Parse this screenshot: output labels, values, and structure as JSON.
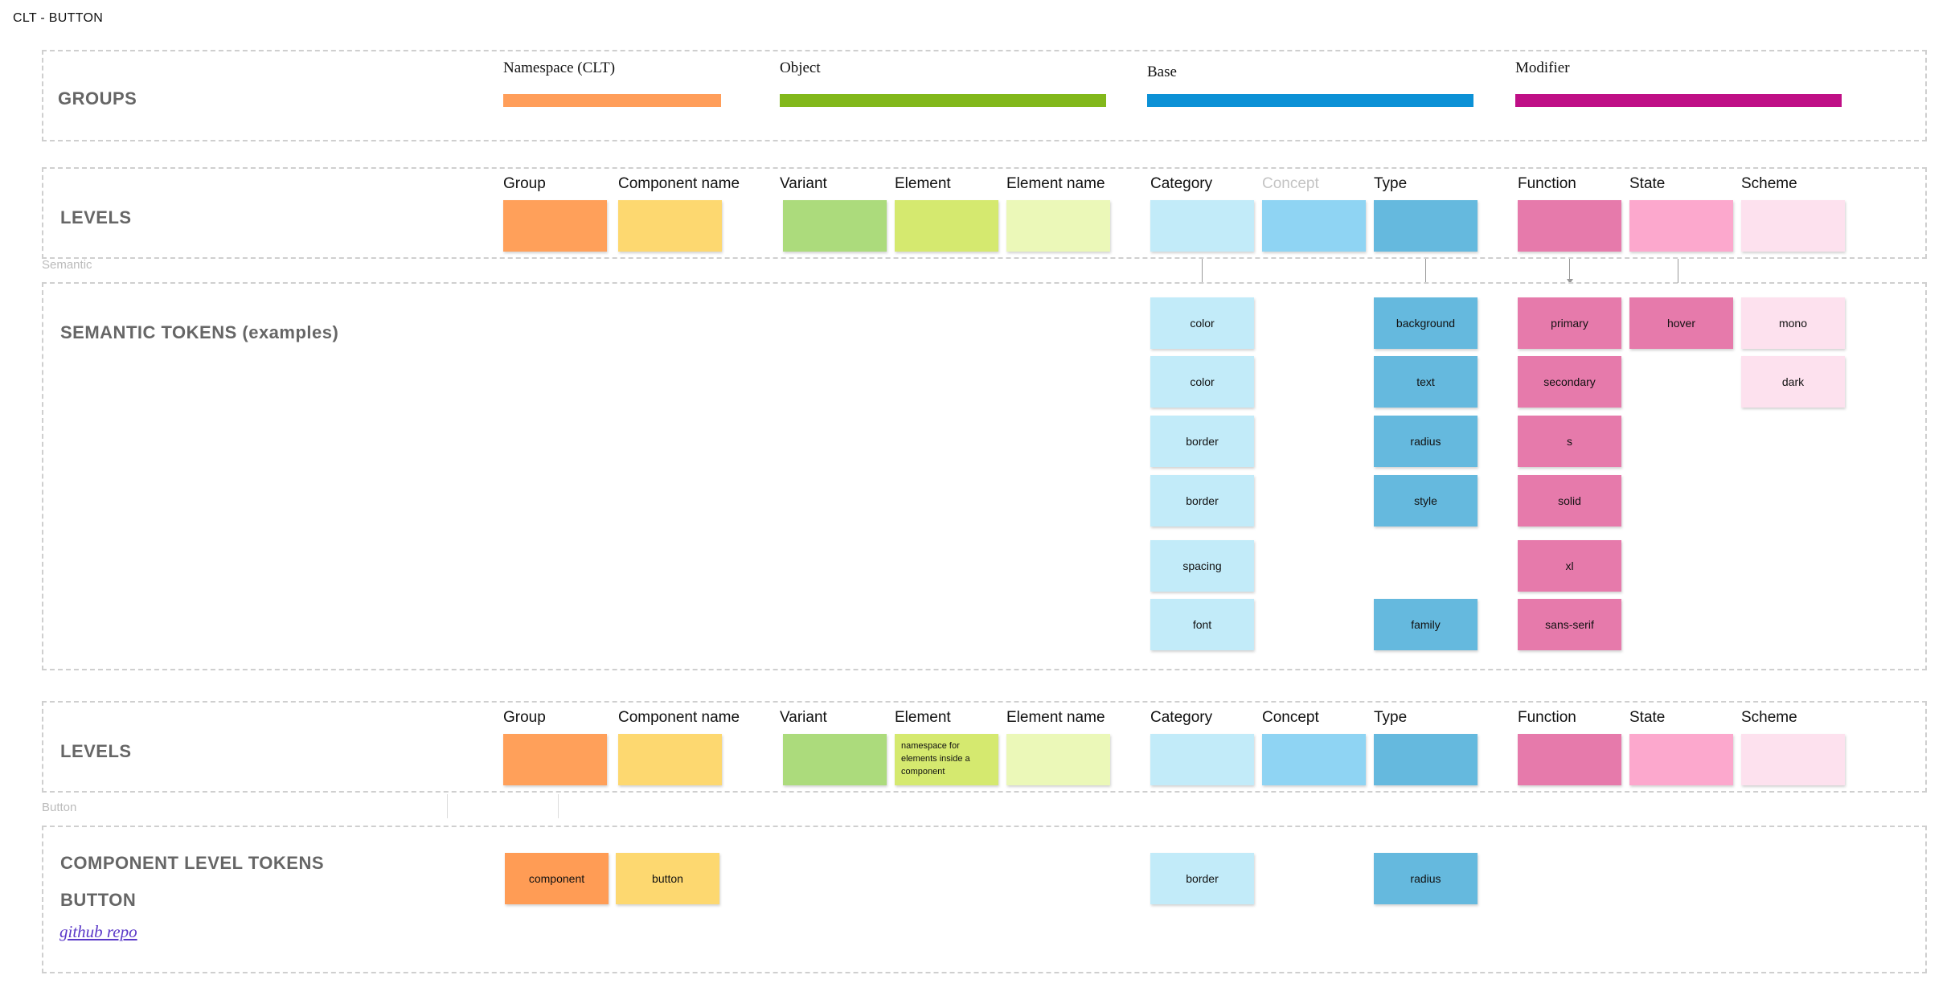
{
  "page_title": "CLT - BUTTON",
  "colors": {
    "group": "#ffa05a",
    "component_name": "#fdd870",
    "variant": "#acdb7c",
    "element": "#d5e96f",
    "element_name": "#ebf8b8",
    "category": "#c2ebf9",
    "concept": "#8fd4f3",
    "type": "#65b9de",
    "function": "#e67aab",
    "state": "#fca8cd",
    "scheme": "#fde1ee",
    "bar_namespace": "#ff9e5a",
    "bar_object": "#82b81b",
    "bar_base": "#0c91d6",
    "bar_modifier": "#bf0f86",
    "link": "#5a38c8"
  },
  "groups": {
    "title": "GROUPS",
    "items": [
      {
        "label": "Namespace (CLT)"
      },
      {
        "label": "Object"
      },
      {
        "label": "Base"
      },
      {
        "label": "Modifier"
      }
    ]
  },
  "levels_top": {
    "title": "LEVELS",
    "labels": [
      "Group",
      "Component name",
      "Variant",
      "Element",
      "Element name",
      "Category",
      "Concept",
      "Type",
      "Function",
      "State",
      "Scheme"
    ]
  },
  "semantic_label": "Semantic",
  "semantic": {
    "title": "SEMANTIC TOKENS (examples)",
    "category": [
      "color",
      "color",
      "border",
      "border",
      "spacing",
      "font"
    ],
    "type": [
      "background",
      "text",
      "radius",
      "style",
      "family"
    ],
    "function": [
      "primary",
      "secondary",
      "s",
      "solid",
      "xl",
      "sans-serif"
    ],
    "state": [
      "hover"
    ],
    "scheme": [
      "mono",
      "dark"
    ]
  },
  "levels_bottom": {
    "title": "LEVELS",
    "labels": [
      "Group",
      "Component name",
      "Variant",
      "Element",
      "Element name",
      "Category",
      "Concept",
      "Type",
      "Function",
      "State",
      "Scheme"
    ],
    "element_note": "namespace for elements inside a component"
  },
  "button_label": "Button",
  "component": {
    "title": "COMPONENT LEVEL TOKENS",
    "subtitle": "BUTTON",
    "link_text": "github repo",
    "tokens": {
      "group": "component",
      "component_name": "button",
      "category": "border",
      "type": "radius"
    }
  }
}
